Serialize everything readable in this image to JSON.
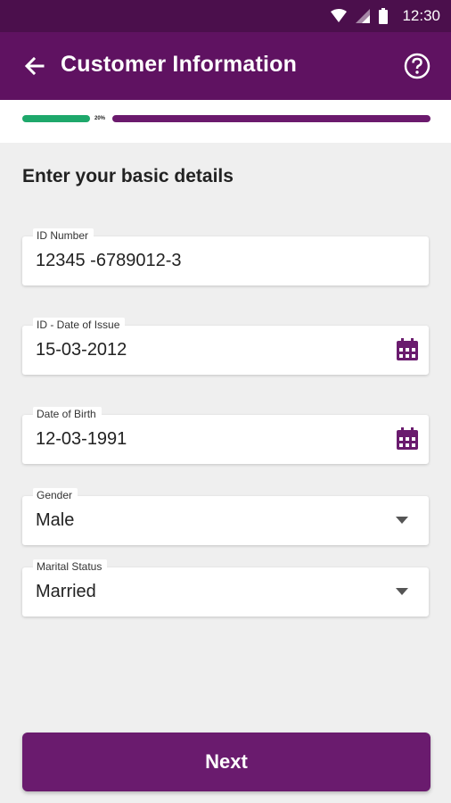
{
  "status_bar": {
    "time": "12:30"
  },
  "app_bar": {
    "title": "Customer Information"
  },
  "progress": {
    "percent_label": "20%",
    "fraction": 0.2
  },
  "section": {
    "title": "Enter your basic details"
  },
  "fields": [
    {
      "label": "ID Number",
      "value": "12345 -6789012-3"
    },
    {
      "label": "ID - Date of Issue",
      "value": "15-03-2012"
    },
    {
      "label": "Date of Birth",
      "value": "12-03-1991"
    },
    {
      "label": "Gender",
      "value": "Male"
    },
    {
      "label": "Marital Status",
      "value": "Married"
    }
  ],
  "actions": {
    "next_label": "Next"
  },
  "colors": {
    "status_bar": "#4b0f4c",
    "app_bar": "#5f1261",
    "accent_purple": "#6a1b6e",
    "progress_green": "#1ea86b"
  }
}
